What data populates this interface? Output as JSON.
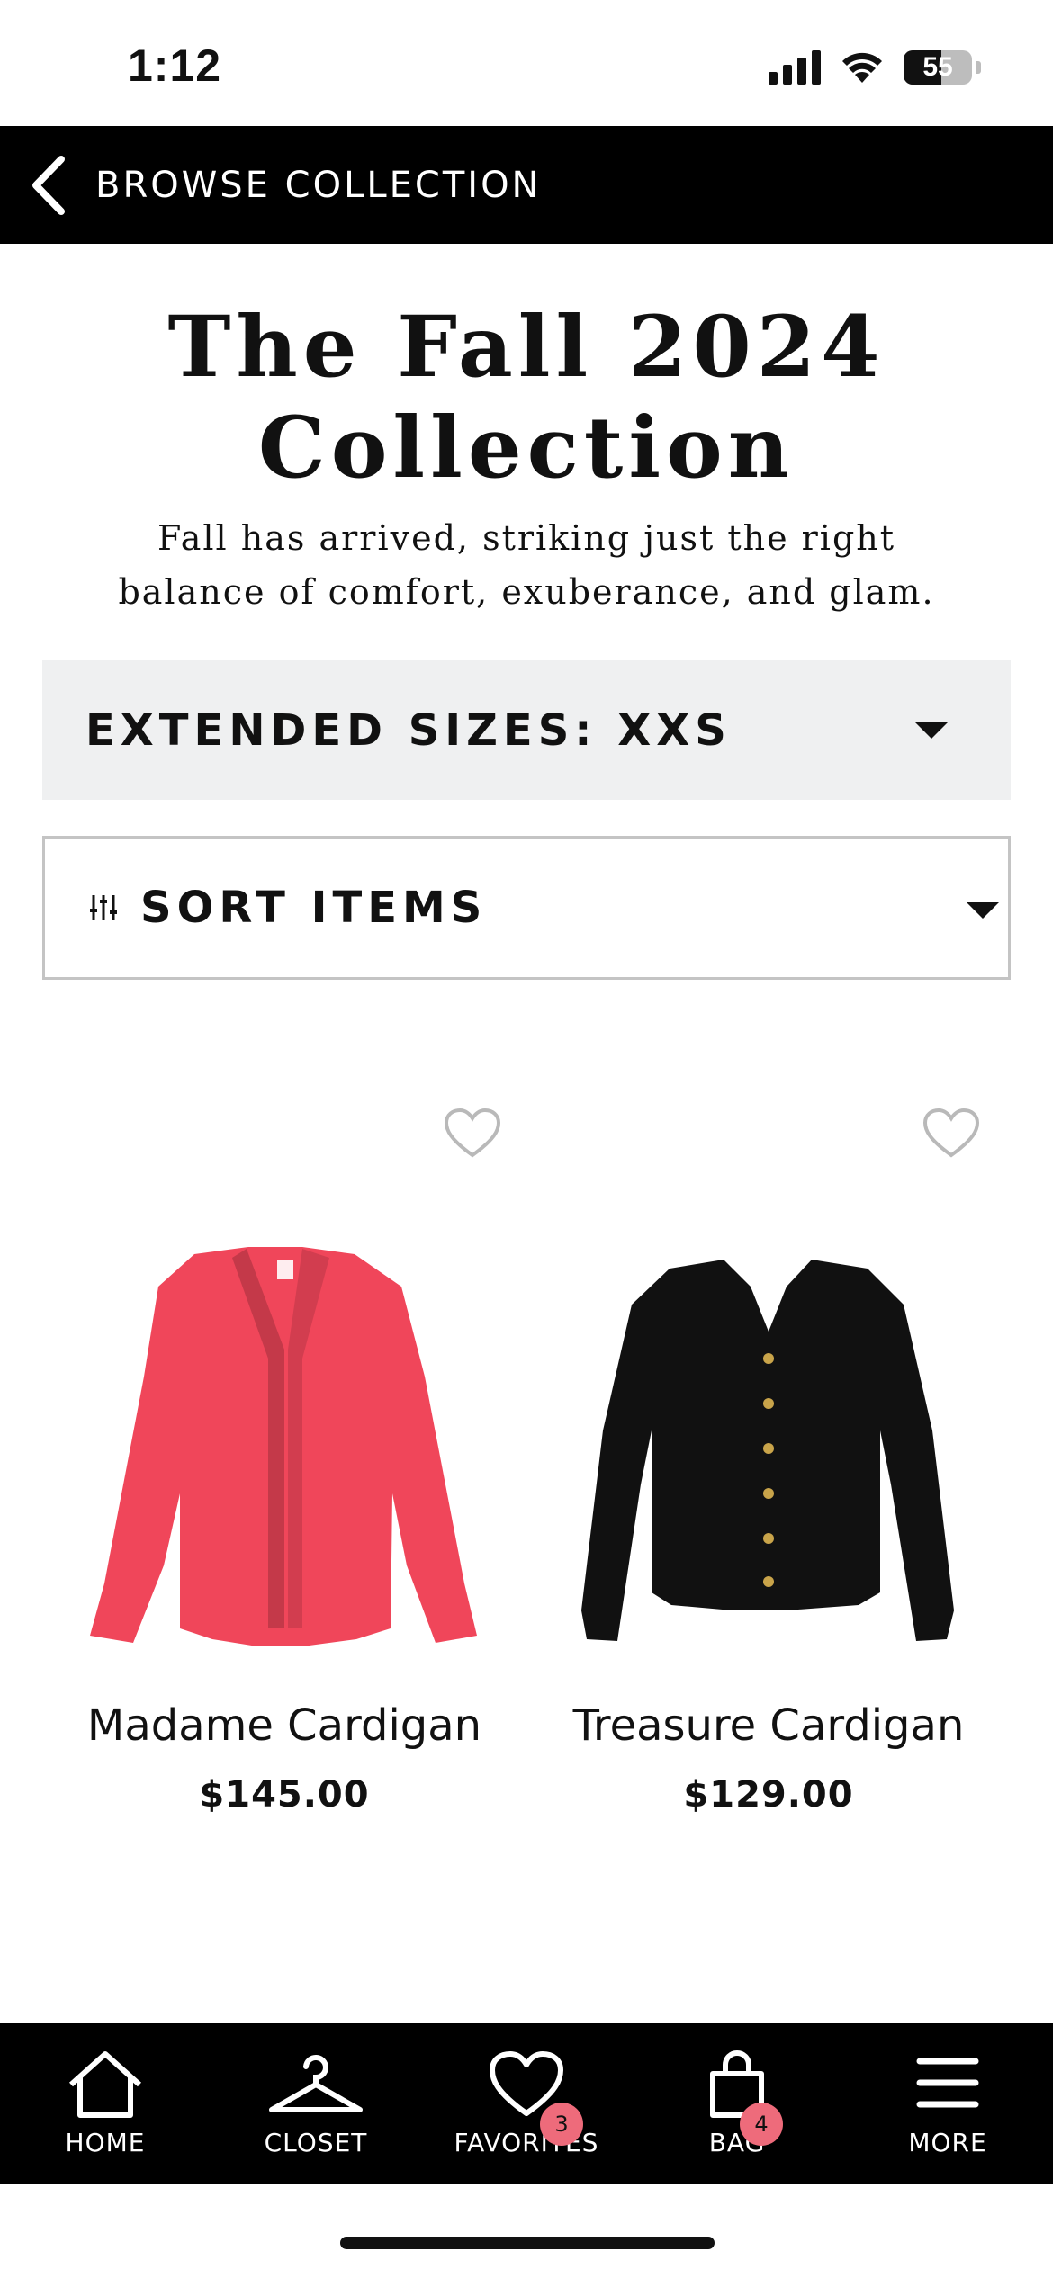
{
  "status_bar": {
    "time": "1:12",
    "battery": "55",
    "battery_level": 0.55,
    "icons": [
      "signal-icon",
      "wifi-icon",
      "battery-icon"
    ]
  },
  "nav": {
    "back_icon": "chevron-left-icon",
    "title": "BROWSE COLLECTION"
  },
  "header": {
    "title": "The Fall 2024 Collection",
    "subtitle": "Fall has arrived, striking just the right balance of comfort, exuberance, and glam."
  },
  "filters": {
    "size_label": "EXTENDED SIZES: XXS",
    "sort_label": "SORT ITEMS",
    "sort_icon": "sliders-icon",
    "caret_icon": "caret-down-icon"
  },
  "products": [
    {
      "name": "Madame Cardigan",
      "price": "$145.00",
      "color": "#f0465a",
      "favorite_icon": "heart-outline-icon"
    },
    {
      "name": "Treasure Cardigan",
      "price": "$129.00",
      "color": "#111111",
      "favorite_icon": "heart-outline-icon"
    }
  ],
  "tab_bar": {
    "tabs": [
      {
        "label": "HOME",
        "icon": "home-icon"
      },
      {
        "label": "CLOSET",
        "icon": "hanger-icon"
      },
      {
        "label": "FAVORITES",
        "icon": "heart-icon",
        "badge": "3"
      },
      {
        "label": "BAG",
        "icon": "shopping-bag-icon",
        "badge": "4"
      },
      {
        "label": "MORE",
        "icon": "menu-icon"
      }
    ]
  },
  "colors": {
    "nav_background": "#000000",
    "filter_background": "#eff0f1",
    "badge": "#ee6b7b"
  }
}
